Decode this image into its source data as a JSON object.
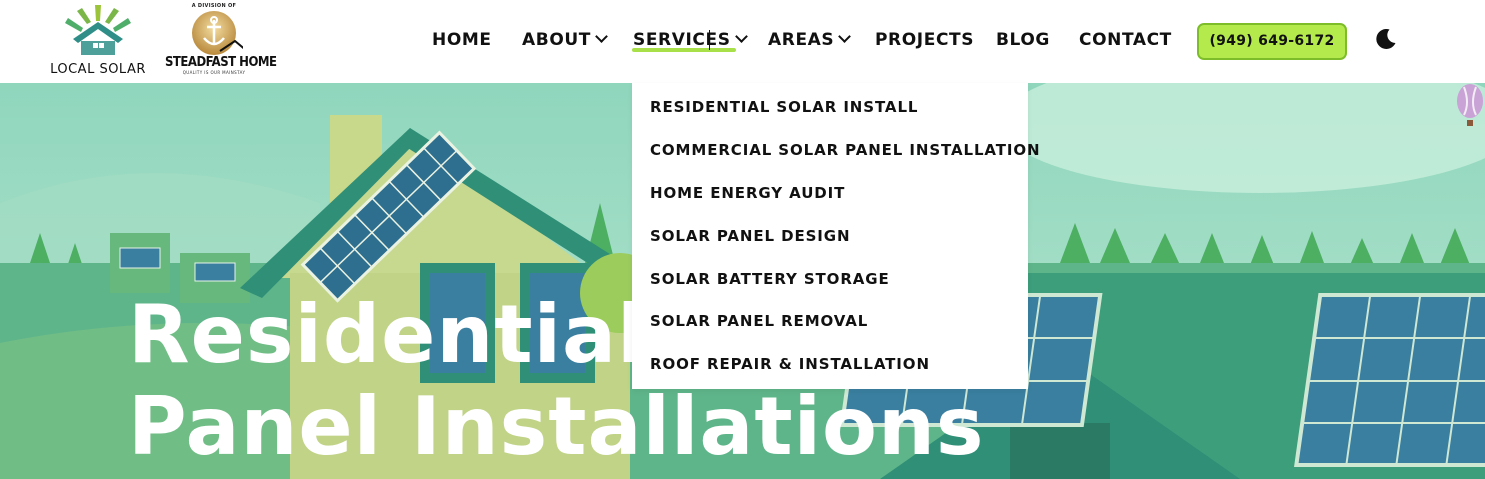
{
  "brand": {
    "local_solar": "LOCAL SOLAR",
    "division_of": "A DIVISION OF",
    "steadfast": "STEADFAST HOME",
    "steadfast_tagline": "QUALITY IS OUR MAINSTAY"
  },
  "nav": {
    "items": [
      {
        "label": "HOME",
        "has_dropdown": false
      },
      {
        "label": "ABOUT",
        "has_dropdown": true
      },
      {
        "label": "SERVICES",
        "has_dropdown": true,
        "active": true
      },
      {
        "label": "AREAS",
        "has_dropdown": true
      },
      {
        "label": "PROJECTS",
        "has_dropdown": false
      },
      {
        "label": "BLOG",
        "has_dropdown": false
      },
      {
        "label": "CONTACT",
        "has_dropdown": false
      }
    ],
    "phone": "(949) 649-6172",
    "theme_toggle_icon": "moon-icon"
  },
  "services_menu": [
    "RESIDENTIAL SOLAR INSTALL",
    "COMMERCIAL SOLAR PANEL INSTALLATION",
    "HOME ENERGY AUDIT",
    "SOLAR PANEL DESIGN",
    "SOLAR BATTERY STORAGE",
    "SOLAR PANEL REMOVAL",
    "ROOF REPAIR & INSTALLATION"
  ],
  "hero": {
    "title_line1": "Residential Solar",
    "title_line2": "Panel Installations"
  },
  "colors": {
    "accent": "#b5ea4c",
    "accent_border": "#7dbd2a",
    "hero_green": "#3d9e7c",
    "text": "#111111"
  }
}
